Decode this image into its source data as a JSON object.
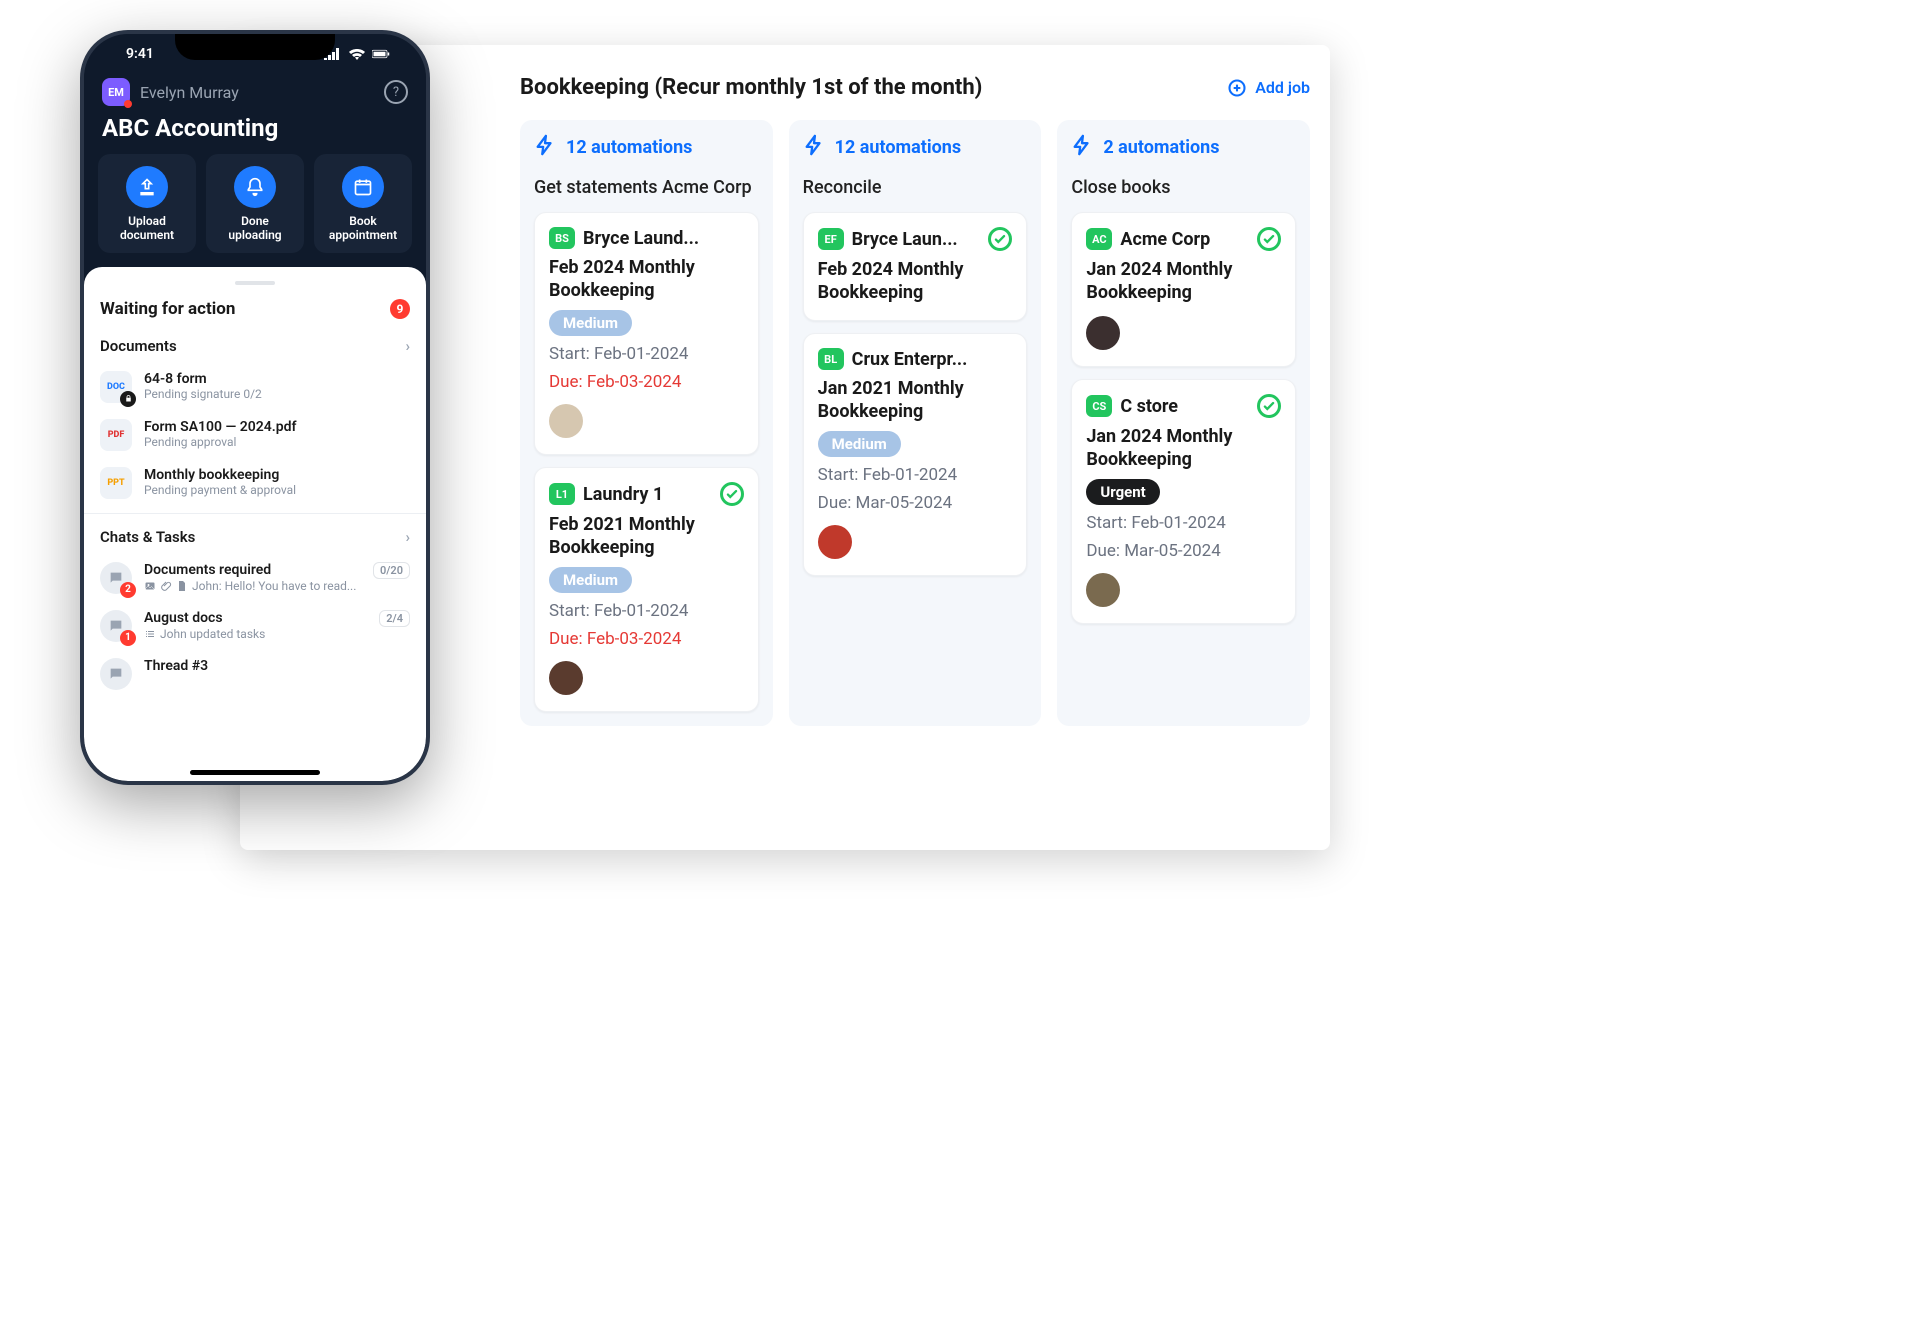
{
  "board": {
    "title": "Bookkeeping (Recur monthly 1st of the month)",
    "add_job": "Add job"
  },
  "columns": [
    {
      "auto": "12 automations",
      "subtitle": "Get statements Acme Corp",
      "cards": [
        {
          "badge": "BS",
          "badge_color": "#22c55e",
          "customer": "Bryce Laund...",
          "title": "Feb 2024 Monthly Bookkeeping",
          "priority": "Medium",
          "priority_style": "med",
          "start": "Start: Feb-01-2024",
          "due": "Due: Feb-03-2024",
          "due_red": true,
          "check": false,
          "assignee_color": "#d6c7b0"
        },
        {
          "badge": "L1",
          "badge_color": "#22c55e",
          "customer": "Laundry 1",
          "title": "Feb 2021 Monthly Bookkeeping",
          "priority": "Medium",
          "priority_style": "med",
          "start": "Start: Feb-01-2024",
          "due": "Due: Feb-03-2024",
          "due_red": true,
          "check": true,
          "assignee_color": "#5a3b2e"
        }
      ]
    },
    {
      "auto": "12 automations",
      "subtitle": "Reconcile",
      "cards": [
        {
          "badge": "EF",
          "badge_color": "#22c55e",
          "customer": "Bryce Laun...",
          "title": "Feb 2024 Monthly Bookkeeping",
          "check": true
        },
        {
          "badge": "BL",
          "badge_color": "#22c55e",
          "customer": "Crux Enterpr...",
          "title": "Jan 2021 Monthly Bookkeeping",
          "priority": "Medium",
          "priority_style": "med",
          "start": "Start: Feb-01-2024",
          "due": "Due: Mar-05-2024",
          "due_red": false,
          "check": false,
          "assignee_color": "#c0392b"
        }
      ]
    },
    {
      "auto": "2 automations",
      "subtitle": "Close books",
      "cards": [
        {
          "badge": "AC",
          "badge_color": "#22c55e",
          "customer": "Acme Corp",
          "title": "Jan 2024 Monthly Bookkeeping",
          "check": true,
          "assignee_color": "#3b2f2f"
        },
        {
          "badge": "CS",
          "badge_color": "#22c55e",
          "customer": "C store",
          "title": "Jan 2024 Monthly Bookkeeping",
          "priority": "Urgent",
          "priority_style": "urg",
          "start": "Start: Feb-01-2024",
          "due": "Due: Mar-05-2024",
          "due_red": false,
          "check": true,
          "assignee_color": "#7a6a4f"
        }
      ]
    }
  ],
  "phone": {
    "time": "9:41",
    "user_initials": "EM",
    "user_name": "Evelyn Murray",
    "app_title": "ABC Accounting",
    "actions": [
      {
        "label_l1": "Upload",
        "label_l2": "document",
        "icon": "upload"
      },
      {
        "label_l1": "Done",
        "label_l2": "uploading",
        "icon": "bell"
      },
      {
        "label_l1": "Book",
        "label_l2": "appointment",
        "icon": "calendar"
      }
    ],
    "waiting_title": "Waiting for action",
    "waiting_count": "9",
    "docs_header": "Documents",
    "documents": [
      {
        "icon": "doc",
        "name": "64-8 form",
        "status": "Pending signature 0/2",
        "lock": true
      },
      {
        "icon": "pdf",
        "name": "Form SA100 — 2024.pdf",
        "status": "Pending approval",
        "lock": false
      },
      {
        "icon": "ppt",
        "name": "Monthly bookkeeping",
        "status": "Pending payment & approval",
        "lock": false
      }
    ],
    "chats_header": "Chats & Tasks",
    "chats": [
      {
        "title": "Documents required",
        "count": "0/20",
        "sub": "John: Hello! You have to read...",
        "badge": "2",
        "icons": [
          "image",
          "clip",
          "file"
        ]
      },
      {
        "title": "August docs",
        "count": "2/4",
        "sub": "John updated tasks",
        "badge": "1",
        "icons": [
          "list"
        ]
      },
      {
        "title": "Thread #3",
        "count": "",
        "sub": "",
        "badge": "",
        "icons": []
      }
    ]
  }
}
